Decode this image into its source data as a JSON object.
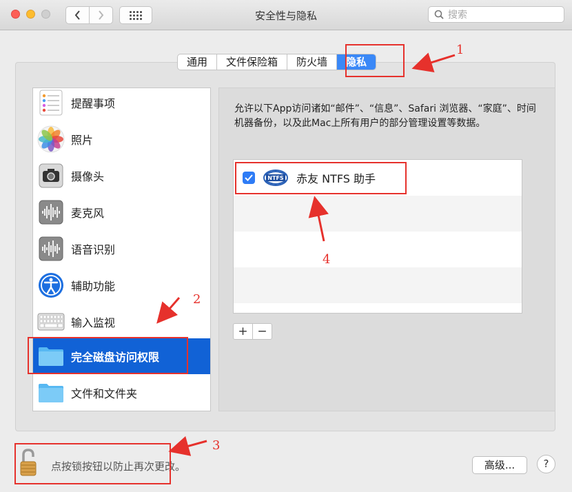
{
  "window": {
    "title": "安全性与隐私"
  },
  "search": {
    "placeholder": "搜索"
  },
  "tabs": [
    {
      "label": "通用",
      "selected": false
    },
    {
      "label": "文件保险箱",
      "selected": false
    },
    {
      "label": "防火墙",
      "selected": false
    },
    {
      "label": "隐私",
      "selected": true
    }
  ],
  "sidebar": {
    "items": [
      {
        "label": "提醒事项",
        "icon": "reminders-icon"
      },
      {
        "label": "照片",
        "icon": "photos-icon"
      },
      {
        "label": "摄像头",
        "icon": "camera-icon"
      },
      {
        "label": "麦克风",
        "icon": "microphone-icon"
      },
      {
        "label": "语音识别",
        "icon": "speech-recognition-icon"
      },
      {
        "label": "辅助功能",
        "icon": "accessibility-icon"
      },
      {
        "label": "输入监视",
        "icon": "keyboard-icon"
      },
      {
        "label": "完全磁盘访问权限",
        "icon": "folder-icon",
        "selected": true
      },
      {
        "label": "文件和文件夹",
        "icon": "folder-icon"
      }
    ]
  },
  "description": "允许以下App访问诸如“邮件”、“信息”、Safari 浏览器、“家庭”、时间机器备份，以及此Mac上所有用户的部分管理设置等数据。",
  "apps": [
    {
      "name": "赤友 NTFS 助手",
      "logo_text": "NTFS",
      "checked": true
    }
  ],
  "controls": {
    "add": "+",
    "remove": "−"
  },
  "lock": {
    "text": "点按锁按钮以防止再次更改。"
  },
  "advanced_button": "高级...",
  "help_button": "?",
  "annotations": [
    "1",
    "2",
    "3",
    "4"
  ],
  "colors": {
    "accent": "#3a88f7",
    "selection": "#1162d6",
    "annotation": "#e6312c"
  }
}
